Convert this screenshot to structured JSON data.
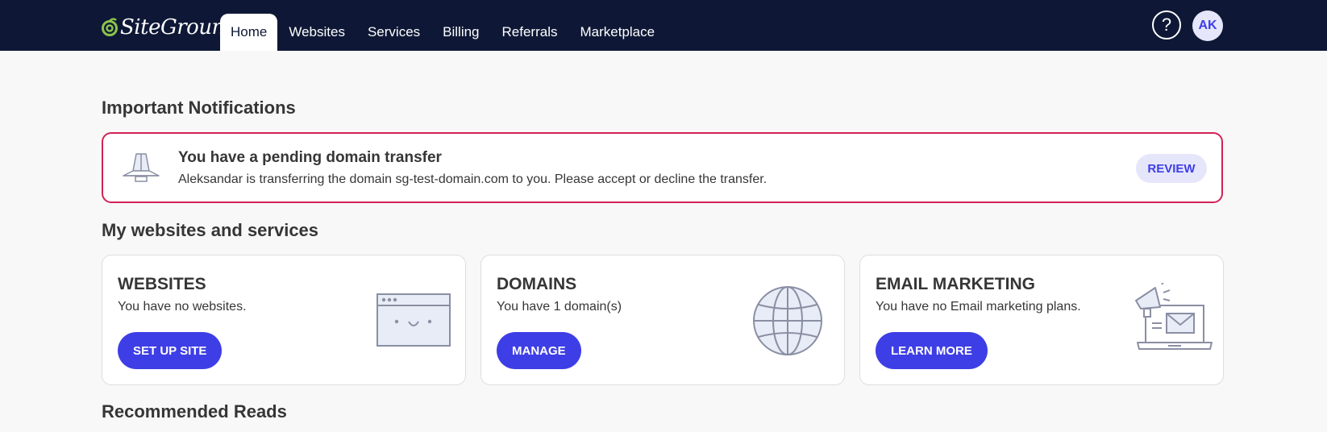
{
  "header": {
    "brand": "SiteGround",
    "nav": [
      {
        "label": "Home",
        "active": true
      },
      {
        "label": "Websites",
        "active": false
      },
      {
        "label": "Services",
        "active": false
      },
      {
        "label": "Billing",
        "active": false
      },
      {
        "label": "Referrals",
        "active": false
      },
      {
        "label": "Marketplace",
        "active": false
      }
    ],
    "help_icon": "question-mark-icon",
    "help_glyph": "?",
    "avatar_initials": "AK"
  },
  "notifications": {
    "section_title": "Important Notifications",
    "item": {
      "icon": "warning-beacon-icon",
      "title": "You have a pending domain transfer",
      "text": "Aleksandar is transferring the domain sg-test-domain.com to you. Please accept or decline the transfer.",
      "action_label": "REVIEW"
    }
  },
  "services": {
    "section_title": "My websites and services",
    "cards": [
      {
        "title": "WEBSITES",
        "text": "You have no websites.",
        "button": "SET UP SITE",
        "icon": "browser-window-icon"
      },
      {
        "title": "DOMAINS",
        "text": "You have 1 domain(s)",
        "button": "MANAGE",
        "icon": "globe-icon"
      },
      {
        "title": "EMAIL MARKETING",
        "text": "You have no Email marketing plans.",
        "button": "LEARN MORE",
        "icon": "megaphone-laptop-icon"
      }
    ]
  },
  "recommended": {
    "section_title": "Recommended Reads"
  },
  "colors": {
    "header_bg": "#0e1836",
    "accent": "#3e3ee6",
    "alert_border": "#d42255",
    "page_bg": "#f8f8f8"
  }
}
